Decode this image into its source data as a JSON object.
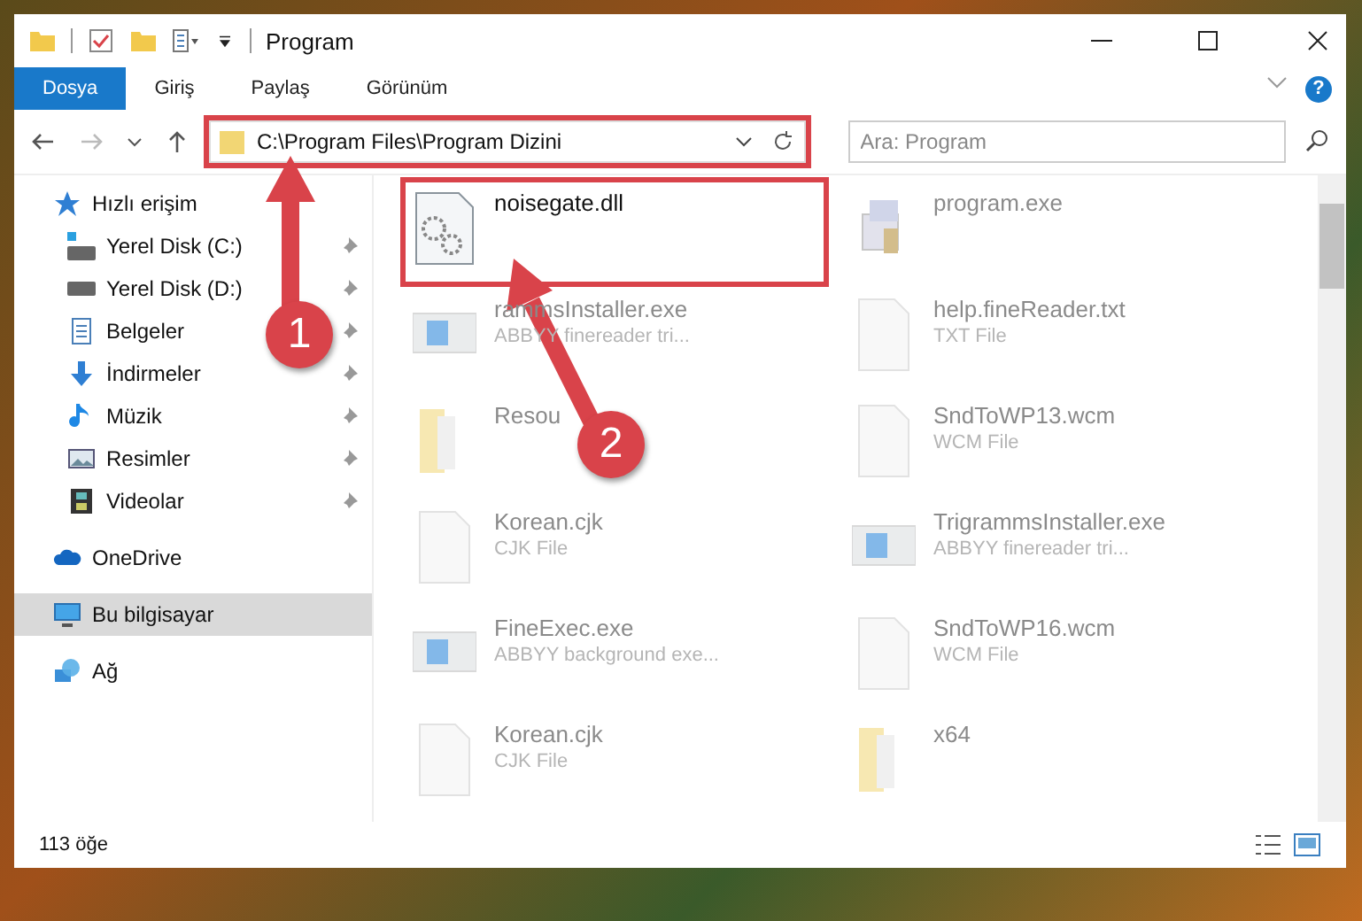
{
  "window": {
    "title": "Program"
  },
  "ribbon": {
    "tabs": [
      {
        "label": "Dosya",
        "selected": true
      },
      {
        "label": "Giriş",
        "selected": false
      },
      {
        "label": "Paylaş",
        "selected": false
      },
      {
        "label": "Görünüm",
        "selected": false
      }
    ]
  },
  "help": {
    "label": "?"
  },
  "address_bar": {
    "path": "C:\\Program Files\\Program Dizini",
    "highlighted": true
  },
  "search": {
    "placeholder": "Ara: Program"
  },
  "sidebar": {
    "items": [
      {
        "label": "Hızlı erişim",
        "kind": "star",
        "pinned": false,
        "selected": false,
        "children": [
          {
            "label": "Yerel Disk (C:)",
            "kind": "drive-c",
            "pinned": true,
            "selected": false
          },
          {
            "label": "Yerel Disk (D:)",
            "kind": "drive",
            "pinned": true,
            "selected": false
          },
          {
            "label": "Belgeler",
            "kind": "docs",
            "pinned": true,
            "selected": false
          },
          {
            "label": "İndirmeler",
            "kind": "download",
            "pinned": true,
            "selected": false
          },
          {
            "label": "Müzik",
            "kind": "music",
            "pinned": true,
            "selected": false
          },
          {
            "label": "Resimler",
            "kind": "pictures",
            "pinned": true,
            "selected": false
          },
          {
            "label": "Videolar",
            "kind": "videos",
            "pinned": true,
            "selected": false
          }
        ]
      },
      {
        "label": "OneDrive",
        "kind": "cloud",
        "pinned": false,
        "selected": false
      },
      {
        "label": "Bu bilgisayar",
        "kind": "pc",
        "pinned": false,
        "selected": true
      },
      {
        "label": "Ağ",
        "kind": "network",
        "pinned": false,
        "selected": false
      }
    ]
  },
  "files": [
    {
      "name": "noisegate.dll",
      "kind": "dll",
      "highlighted": true,
      "dimmed": false
    },
    {
      "name": "program.exe",
      "kind": "installer",
      "highlighted": false,
      "dimmed": true
    },
    {
      "name": "rammsInstaller.exe",
      "type": "ABBYY finereader tri...",
      "kind": "app",
      "highlighted": false,
      "dimmed": true
    },
    {
      "name": "help.fineReader.txt",
      "type": "TXT File",
      "kind": "page",
      "highlighted": false,
      "dimmed": true
    },
    {
      "name": "Resou",
      "kind": "zip",
      "highlighted": false,
      "dimmed": true
    },
    {
      "name": "SndToWP13.wcm",
      "type": "WCM File",
      "kind": "page",
      "highlighted": false,
      "dimmed": true
    },
    {
      "name": "Korean.cjk",
      "type": "CJK File",
      "kind": "page",
      "highlighted": false,
      "dimmed": true
    },
    {
      "name": "TrigrammsInstaller.exe",
      "type": "ABBYY finereader tri...",
      "kind": "app",
      "highlighted": false,
      "dimmed": true
    },
    {
      "name": "FineExec.exe",
      "type": "ABBYY background exe...",
      "kind": "app",
      "highlighted": false,
      "dimmed": true
    },
    {
      "name": "SndToWP16.wcm",
      "type": "WCM File",
      "kind": "page",
      "highlighted": false,
      "dimmed": true
    },
    {
      "name": "Korean.cjk",
      "type": "CJK File",
      "kind": "page",
      "highlighted": false,
      "dimmed": true
    },
    {
      "name": "x64",
      "kind": "zip",
      "highlighted": false,
      "dimmed": true
    }
  ],
  "status_bar": {
    "count": "113 öğe"
  },
  "annotations": [
    {
      "label": "1"
    },
    {
      "label": "2"
    }
  ]
}
